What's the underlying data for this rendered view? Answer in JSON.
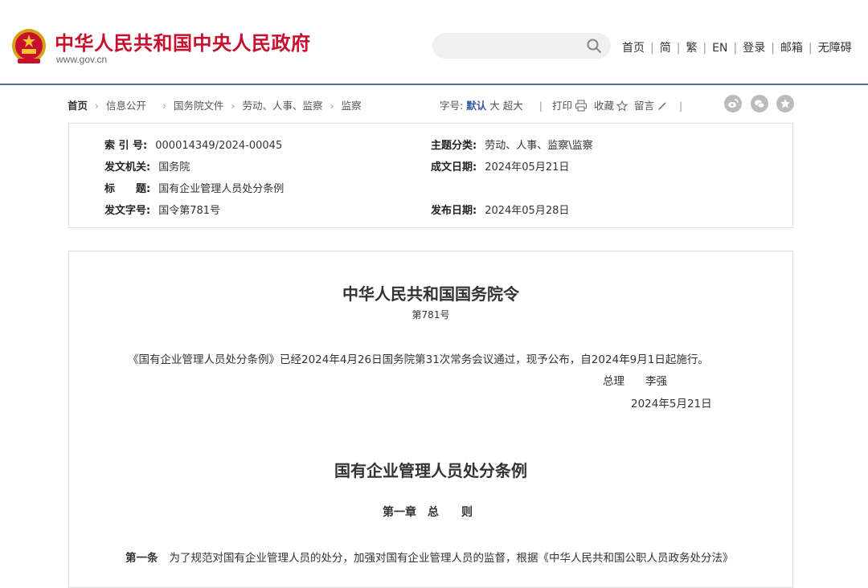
{
  "header": {
    "site_title": "中华人民共和国中央人民政府",
    "site_url": "www.gov.cn",
    "search_placeholder": "",
    "nav": [
      "首页",
      "简",
      "繁",
      "EN",
      "登录",
      "邮箱",
      "无障碍"
    ]
  },
  "breadcrumb": [
    "首页",
    "信息公开",
    "国务院文件",
    "劳动、人事、监察",
    "监察"
  ],
  "tools": {
    "font_size_label": "字号:",
    "font_sizes": [
      "默认",
      "大",
      "超大"
    ],
    "print": "打印",
    "favorite": "收藏",
    "comment": "留言",
    "share_icons": [
      "weibo-icon",
      "wechat-icon",
      "star-icon"
    ]
  },
  "info": {
    "index_label": "索 引 号:",
    "index_value": "000014349/2024-00045",
    "category_label": "主题分类:",
    "category_value": "劳动、人事、监察\\监察",
    "issuer_label": "发文机关:",
    "issuer_value": "国务院",
    "written_label": "成文日期:",
    "written_value": "2024年05月21日",
    "title_label": "标　　题:",
    "title_value": "国有企业管理人员处分条例",
    "doc_no_label": "发文字号:",
    "doc_no_value": "国令第781号",
    "publish_label": "发布日期:",
    "publish_value": "2024年05月28日"
  },
  "document": {
    "order_title": "中华人民共和国国务院令",
    "order_no": "第781号",
    "paragraph": "《国有企业管理人员处分条例》已经2024年4月26日国务院第31次常务会议通过，现予公布，自2024年9月1日起施行。",
    "sign_title": "总理",
    "sign_name": "李强",
    "sign_date": "2024年5月21日",
    "regulation_title": "国有企业管理人员处分条例",
    "chapter": "第一章　总　　则",
    "article_no": "第一条",
    "article_text": "为了规范对国有企业管理人员的处分，加强对国有企业管理人员的监督，根据《中华人民共和国公职人员政务处分法》"
  },
  "colors": {
    "brand_red": "#c8102e",
    "accent_blue": "#3b5aa3",
    "header_rule": "#4a6fa5"
  }
}
